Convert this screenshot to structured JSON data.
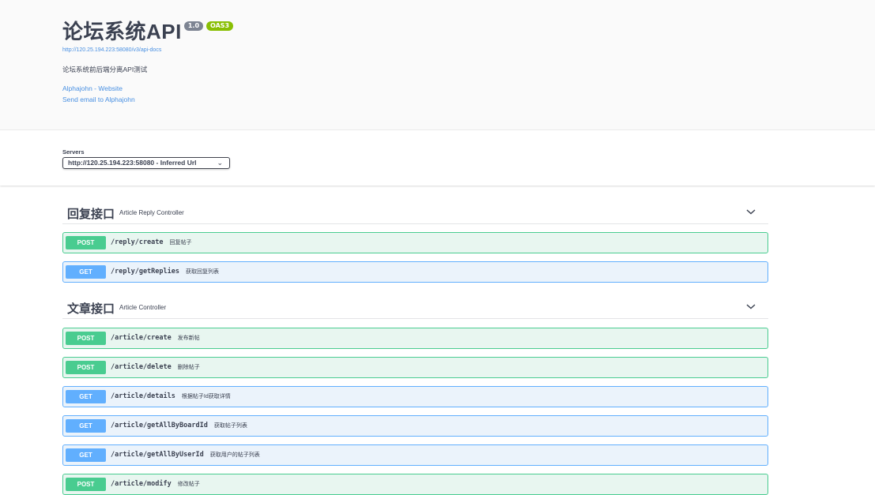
{
  "info": {
    "title": "论坛系统API",
    "version_badge": "1.0",
    "oas_badge": "OAS3",
    "spec_url": "http://120.25.194.223:58080/v3/api-docs",
    "description": "论坛系统前后端分离API测试",
    "website_link": "Alphajohn - Website",
    "email_link": "Send email to Alphajohn"
  },
  "servers": {
    "label": "Servers",
    "selected": "http://120.25.194.223:58080 - Inferred Url"
  },
  "tags": [
    {
      "name": "回复接口",
      "description": "Article Reply Controller",
      "operations": [
        {
          "method": "POST",
          "path": "/reply/create",
          "summary": "回复帖子"
        },
        {
          "method": "GET",
          "path": "/reply/getReplies",
          "summary": "获取回复列表"
        }
      ]
    },
    {
      "name": "文章接口",
      "description": "Article Controller",
      "operations": [
        {
          "method": "POST",
          "path": "/article/create",
          "summary": "发布新帖"
        },
        {
          "method": "POST",
          "path": "/article/delete",
          "summary": "删除帖子"
        },
        {
          "method": "GET",
          "path": "/article/details",
          "summary": "根据帖子Id获取详情"
        },
        {
          "method": "GET",
          "path": "/article/getAllByBoardId",
          "summary": "获取帖子列表"
        },
        {
          "method": "GET",
          "path": "/article/getAllByUserId",
          "summary": "获取用户的帖子列表"
        },
        {
          "method": "POST",
          "path": "/article/modify",
          "summary": "修改帖子"
        }
      ]
    }
  ]
}
